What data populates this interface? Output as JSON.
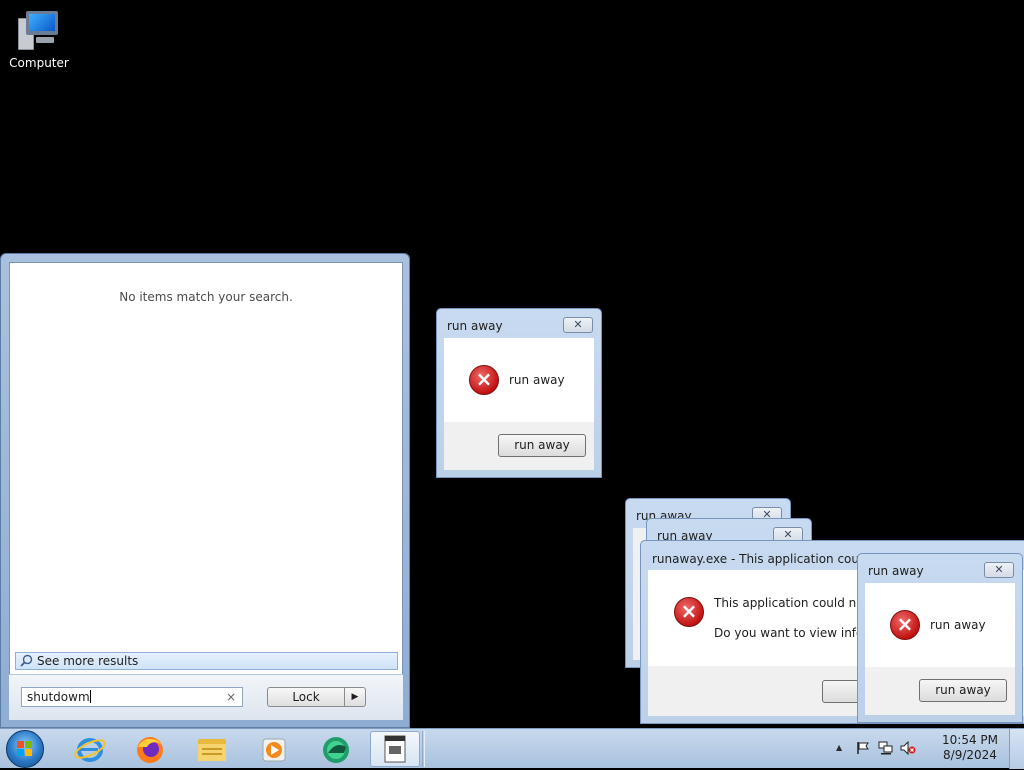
{
  "desktop": {
    "icons": [
      {
        "label": "Computer",
        "icon": "computer-icon"
      }
    ]
  },
  "start_menu": {
    "no_results_text": "No items match your search.",
    "see_more_label": "See more results",
    "search": {
      "value": "shutdowm",
      "clear_glyph": "×"
    },
    "power_button_label": "Lock",
    "power_arrow_glyph": "▶"
  },
  "dialogs": {
    "top": {
      "title": "run away",
      "message": "run away",
      "button": "run away",
      "close_glyph": "✕"
    },
    "back1": {
      "title": "run away",
      "close_glyph": "✕"
    },
    "back2": {
      "title": "run away",
      "close_glyph": "✕"
    },
    "app_error": {
      "title": "runaway.exe - This application could no",
      "line1": "This application could not b",
      "line2": "Do you want to view inform"
    },
    "front": {
      "title": "run away",
      "message": "run away",
      "button": "run away",
      "close_glyph": "✕"
    }
  },
  "taskbar": {
    "pinned": [
      {
        "name": "internet-explorer-icon"
      },
      {
        "name": "firefox-icon"
      },
      {
        "name": "file-explorer-icon"
      },
      {
        "name": "media-player-icon"
      },
      {
        "name": "green-app-icon"
      },
      {
        "name": "runaway-app-icon",
        "active": true
      }
    ],
    "tray": {
      "chevron_glyph": "▲",
      "time": "10:54 PM",
      "date": "8/9/2024"
    }
  },
  "colors": {
    "desktop_background": "#000000",
    "error_red": "#c21313",
    "taskbar": "#b4cbe4"
  }
}
